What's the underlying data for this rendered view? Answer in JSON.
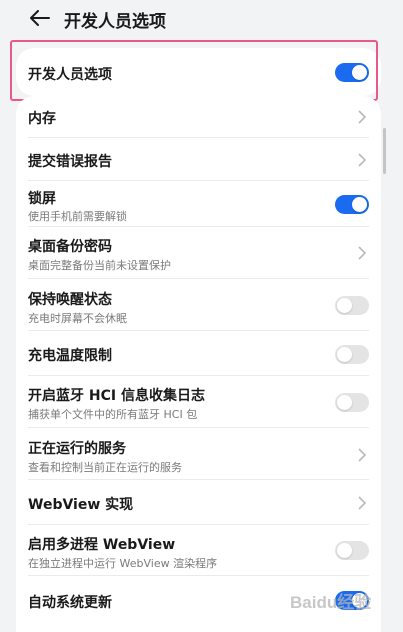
{
  "header": {
    "title": "开发人员选项"
  },
  "developer_option": {
    "label": "开发人员选项",
    "enabled": true
  },
  "settings": [
    {
      "label": "内存",
      "control": "chevron"
    },
    {
      "label": "提交错误报告",
      "control": "chevron"
    },
    {
      "label": "锁屏",
      "sublabel": "使用手机前需要解锁",
      "control": "toggle",
      "enabled": true
    },
    {
      "label": "桌面备份密码",
      "sublabel": "桌面完整备份当前未设置保护",
      "control": "chevron"
    },
    {
      "label": "保持唤醒状态",
      "sublabel": "充电时屏幕不会休眠",
      "control": "toggle",
      "enabled": false
    },
    {
      "label": "充电温度限制",
      "control": "toggle",
      "enabled": false
    },
    {
      "label": "开启蓝牙 HCI 信息收集日志",
      "sublabel": "捕获单个文件中的所有蓝牙 HCI 包",
      "control": "toggle",
      "enabled": false
    },
    {
      "label": "正在运行的服务",
      "sublabel": "查看和控制当前正在运行的服务",
      "control": "chevron"
    },
    {
      "label": "WebView 实现",
      "control": "chevron"
    },
    {
      "label": "启用多进程 WebView",
      "sublabel": "在独立进程中运行 WebView 渲染程序",
      "control": "toggle",
      "enabled": false
    },
    {
      "label": "自动系统更新",
      "control": "toggle",
      "enabled": true
    }
  ],
  "watermark": {
    "text": "Baidu经验"
  },
  "colors": {
    "accent": "#1a6bf0",
    "highlight": "#e8588a",
    "background": "#f1f3f5"
  }
}
